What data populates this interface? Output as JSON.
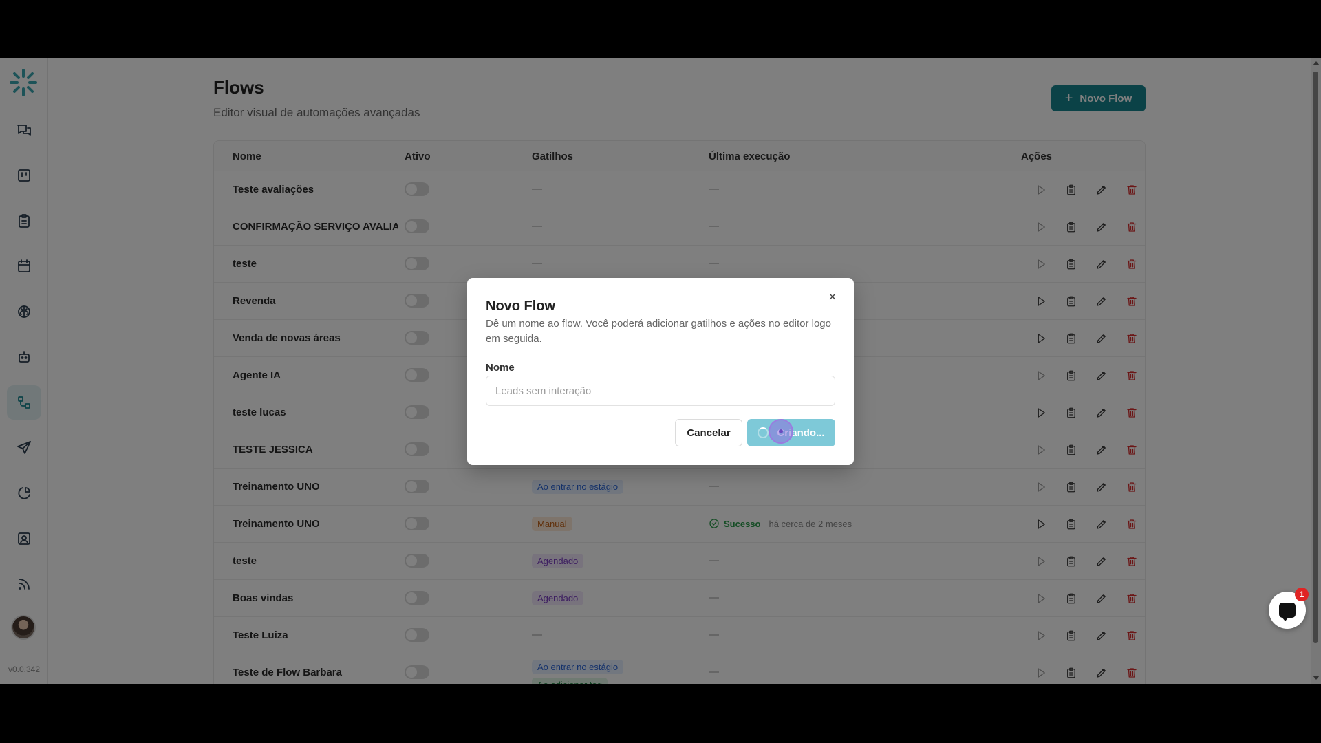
{
  "app": {
    "version": "v0.0.342"
  },
  "page": {
    "title": "Flows",
    "subtitle": "Editor visual de automações avançadas",
    "new_button": "Novo Flow",
    "new_button_plus": "+"
  },
  "sidebar": {
    "items": [
      {
        "icon": "chat-icon"
      },
      {
        "icon": "kanban-icon"
      },
      {
        "icon": "clipboard-icon"
      },
      {
        "icon": "calendar-icon"
      },
      {
        "icon": "brain-icon"
      },
      {
        "icon": "bot-icon"
      },
      {
        "icon": "flows-icon",
        "active": true
      },
      {
        "icon": "send-icon"
      },
      {
        "icon": "pie-chart-icon"
      },
      {
        "icon": "contacts-icon"
      },
      {
        "icon": "rss-icon"
      }
    ]
  },
  "table": {
    "headers": {
      "name": "Nome",
      "active": "Ativo",
      "triggers": "Gatilhos",
      "last_run": "Última execução",
      "actions": "Ações"
    },
    "dash": "—",
    "rows": [
      {
        "name": "Teste avaliações",
        "trigger": "—",
        "last": "—",
        "play_dim": true
      },
      {
        "name": "CONFIRMAÇÃO SERVIÇO AVALIAÇ",
        "trigger": "—",
        "last": "—",
        "play_dim": true
      },
      {
        "name": "teste",
        "trigger": "—",
        "last": "—",
        "play_dim": true
      },
      {
        "name": "Revenda",
        "trigger": "",
        "last": "",
        "play_dim": false
      },
      {
        "name": "Venda de novas áreas",
        "trigger": "",
        "last": "",
        "play_dim": false
      },
      {
        "name": "Agente IA",
        "trigger": "",
        "last": "",
        "play_dim": true
      },
      {
        "name": "teste lucas",
        "trigger": "",
        "last": "",
        "play_dim": false
      },
      {
        "name": "TESTE JESSICA",
        "trigger": "",
        "last": "",
        "play_dim": true
      },
      {
        "name": "Treinamento UNO",
        "trigger_badge": "Ao entrar no estágio",
        "badge_color": "blue",
        "last": "—",
        "play_dim": true
      },
      {
        "name": "Treinamento UNO",
        "trigger_badge": "Manual",
        "badge_color": "orange",
        "status": "Sucesso",
        "when": "há cerca de 2 meses",
        "play_dim": false
      },
      {
        "name": "teste",
        "trigger_badge": "Agendado",
        "badge_color": "purple",
        "last": "—",
        "play_dim": true
      },
      {
        "name": "Boas vindas",
        "trigger_badge": "Agendado",
        "badge_color": "purple",
        "last": "—",
        "play_dim": true
      },
      {
        "name": "Teste Luiza",
        "trigger": "—",
        "last": "—",
        "play_dim": true
      },
      {
        "name": "Teste de Flow Barbara",
        "trigger_badge": "Ao entrar no estágio",
        "badge_color": "blue",
        "trigger_badge_2": "Ao adicionar tag",
        "last": "—",
        "play_dim": true
      }
    ]
  },
  "dialog": {
    "title": "Novo Flow",
    "description": "Dê um nome ao flow. Você poderá adicionar gatilhos e ações no editor logo em seguida.",
    "label": "Nome",
    "placeholder": "Leads sem interação",
    "value": "",
    "cancel": "Cancelar",
    "submit": "Criando...",
    "close": "×"
  },
  "chat_widget": {
    "badge": "1"
  },
  "colors": {
    "accent": "#17858f",
    "danger": "#d62c2c"
  }
}
